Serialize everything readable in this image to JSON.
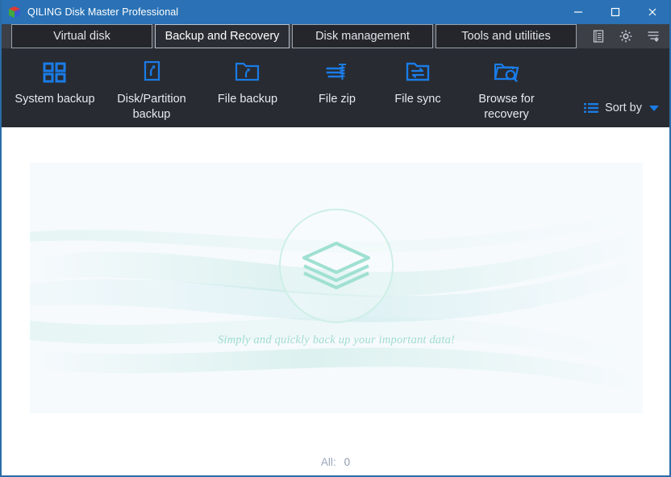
{
  "window": {
    "title": "QILING Disk Master Professional",
    "app_icon": "cube-icon",
    "controls": [
      {
        "name": "minimize-button",
        "icon": "minimize-icon"
      },
      {
        "name": "maximize-button",
        "icon": "maximize-icon"
      },
      {
        "name": "close-button",
        "icon": "close-icon"
      }
    ]
  },
  "tabs": [
    {
      "label": "Virtual disk",
      "active": false,
      "key": "virtual"
    },
    {
      "label": "Backup and Recovery",
      "active": true,
      "key": "backup"
    },
    {
      "label": "Disk management",
      "active": false,
      "key": "disk"
    },
    {
      "label": "Tools and utilities",
      "active": false,
      "key": "tools"
    }
  ],
  "tabbar_icons": [
    {
      "name": "log-icon",
      "label": "Log"
    },
    {
      "name": "gear-icon",
      "label": "Settings"
    },
    {
      "name": "menu-icon",
      "label": "Menu"
    }
  ],
  "toolbar": {
    "items": [
      {
        "label": "System backup",
        "icon": "windows-grid-icon"
      },
      {
        "label": "Disk/Partition backup",
        "icon": "disk-partition-icon"
      },
      {
        "label": "File backup",
        "icon": "folder-backup-icon"
      },
      {
        "label": "File zip",
        "icon": "file-zip-icon"
      },
      {
        "label": "File sync",
        "icon": "folder-sync-icon"
      },
      {
        "label": "Browse for recovery",
        "icon": "folder-search-icon"
      }
    ],
    "sort_by": {
      "label": "Sort by",
      "list_icon": "list-icon",
      "caret_icon": "chevron-down-icon"
    }
  },
  "main": {
    "watermark_icon": "layers-stack-icon",
    "tagline": "Simply and quickly back up your important data!"
  },
  "status": {
    "all_label": "All:",
    "all_value": "0"
  },
  "colors": {
    "titlebar": "#2a72b5",
    "toolbar": "#282b31",
    "tabbar": "#3c3f45",
    "accent_blue": "#1a7ce8",
    "panel": "#f6fafd",
    "teal": "#9fdcd0"
  }
}
